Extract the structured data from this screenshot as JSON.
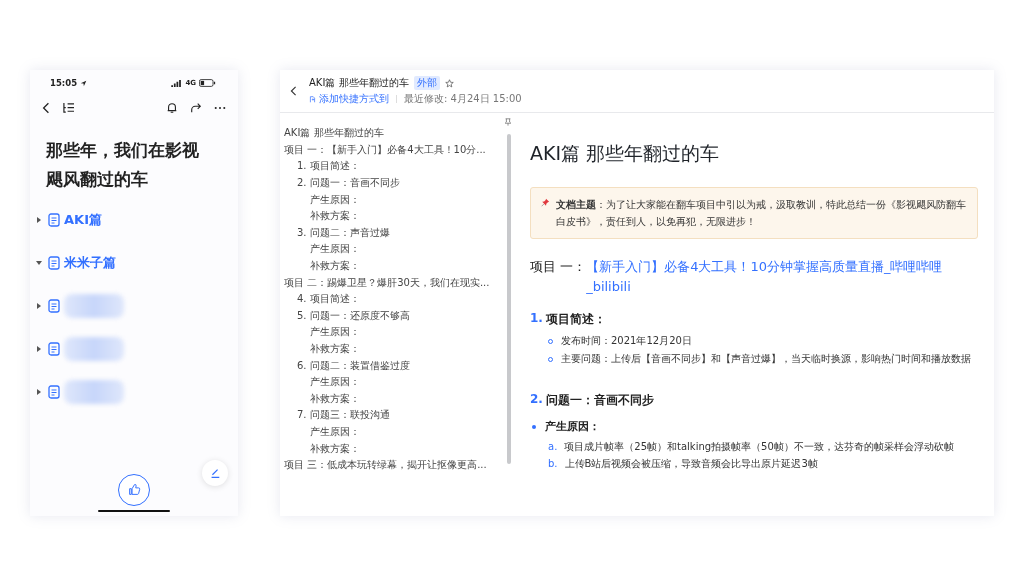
{
  "phone": {
    "status_bar": {
      "time": "15:05",
      "network": "4G"
    },
    "title": "那些年，我们在影视飓风翻过的车",
    "tree": [
      {
        "kind": "doc",
        "label": "AKI篇",
        "expanded": false
      },
      {
        "kind": "doc",
        "label": "米米子篇",
        "expanded": true
      },
      {
        "kind": "redacted",
        "expanded": false
      },
      {
        "kind": "redacted",
        "expanded": false
      },
      {
        "kind": "redacted",
        "expanded": false
      }
    ]
  },
  "document": {
    "header": {
      "title": "AKI篇 那些年翻过的车",
      "badge": "外部",
      "shortcut_link": "添加快捷方式到",
      "modified": "最近修改: 4月24日 15:00"
    },
    "outline": [
      {
        "text": "AKI篇 那些年翻过的车"
      },
      {
        "text": "项目 一：【新手入门】必备4大工具！10分...",
        "children": [
          {
            "text": "1. 项目简述："
          },
          {
            "text": "2. 问题一：音画不同步",
            "children": [
              {
                "text": "产生原因："
              },
              {
                "text": "补救方案："
              }
            ]
          },
          {
            "text": "3. 问题二：声音过爆",
            "children": [
              {
                "text": "产生原因："
              },
              {
                "text": "补救方案："
              }
            ]
          }
        ]
      },
      {
        "text": "项目 二：踢爆卫星？爆肝30天，我们在现实...",
        "children": [
          {
            "text": "4. 项目简述："
          },
          {
            "text": "5. 问题一：还原度不够高",
            "children": [
              {
                "text": "产生原因："
              },
              {
                "text": "补救方案："
              }
            ]
          },
          {
            "text": "6. 问题二：装置借鉴过度",
            "children": [
              {
                "text": "产生原因："
              },
              {
                "text": "补救方案："
              }
            ]
          },
          {
            "text": "7. 问题三：联投沟通",
            "children": [
              {
                "text": "产生原因："
              },
              {
                "text": "补救方案："
              }
            ]
          }
        ]
      },
      {
        "text": "项目 三：低成本玩转绿幕，揭开让抠像更高..."
      }
    ],
    "title": "AKI篇 那些年翻过的车",
    "callout": "**文档主题**：为了让大家能在翻车项目中引以为戒，汲取教训，特此总结一份《影视飓风防翻车白皮书》，责任到人，以免再犯，无限进步！",
    "project": {
      "label": "项目 一：",
      "link": "【新手入门】必备4大工具！10分钟掌握高质量直播_哔哩哔哩_bilibili"
    },
    "sections": [
      {
        "number": "1.",
        "title": "项目简述：",
        "bullets": [
          "发布时间：2021年12月20日",
          "主要问题：上传后【音画不同步】和【声音过爆】，当天临时换源，影响热门时间和播放数据"
        ]
      },
      {
        "number": "2.",
        "title": "问题一：音画不同步",
        "subsections": [
          {
            "title": "产生原因：",
            "items": [
              {
                "marker": "a.",
                "text": "项目成片帧率（25帧）和talking拍摄帧率（50帧）不一致，达芬奇的帧采样会浮动砍帧"
              },
              {
                "marker": "b.",
                "text": "上传B站后视频会被压缩，导致音频会比导出原片延迟3帧"
              }
            ]
          }
        ]
      }
    ]
  }
}
